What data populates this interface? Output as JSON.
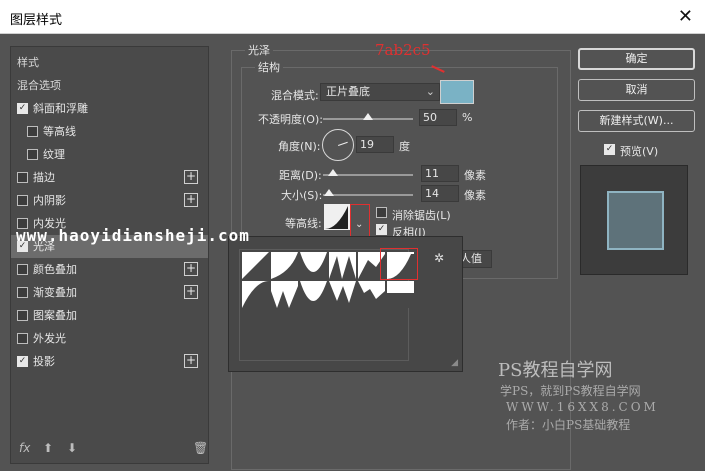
{
  "window": {
    "title": "图层样式",
    "close_label": "✕"
  },
  "left_list": {
    "header": "样式",
    "blend_options": "混合选项",
    "items": [
      {
        "label": "斜面和浮雕",
        "checked": true,
        "indent": 0,
        "plus": false
      },
      {
        "label": "等高线",
        "checked": false,
        "indent": 1,
        "plus": false
      },
      {
        "label": "纹理",
        "checked": false,
        "indent": 1,
        "plus": false
      },
      {
        "label": "描边",
        "checked": false,
        "indent": 0,
        "plus": true
      },
      {
        "label": "内阴影",
        "checked": false,
        "indent": 0,
        "plus": true
      },
      {
        "label": "内发光",
        "checked": false,
        "indent": 0,
        "plus": false
      },
      {
        "label": "光泽",
        "checked": true,
        "indent": 0,
        "plus": false,
        "selected": true
      },
      {
        "label": "颜色叠加",
        "checked": false,
        "indent": 0,
        "plus": true
      },
      {
        "label": "渐变叠加",
        "checked": false,
        "indent": 0,
        "plus": true
      },
      {
        "label": "图案叠加",
        "checked": false,
        "indent": 0,
        "plus": false
      },
      {
        "label": "外发光",
        "checked": false,
        "indent": 0,
        "plus": false
      },
      {
        "label": "投影",
        "checked": true,
        "indent": 0,
        "plus": true
      }
    ],
    "bottom": {
      "fx": "fx",
      "up": "⬆",
      "down": "⬇",
      "trash": "🗑"
    }
  },
  "satin": {
    "group_title": "光泽",
    "structure_title": "结构",
    "blend_mode_label": "混合模式:",
    "blend_mode_value": "正片叠底",
    "color_hex": "#7ab2c5",
    "opacity_label": "不透明度(O):",
    "opacity_value": "50",
    "opacity_unit": "%",
    "angle_label": "角度(N):",
    "angle_value": "19",
    "angle_unit": "度",
    "distance_label": "距离(D):",
    "distance_value": "11",
    "distance_unit": "像素",
    "size_label": "大小(S):",
    "size_value": "14",
    "size_unit": "像素",
    "contour_label": "等高线:",
    "antialias_label": "消除锯齿(L)",
    "antialias_checked": false,
    "invert_label": "反相(I)",
    "invert_checked": true,
    "reset_partial": "人值",
    "levels": {
      "opacity": 0.5,
      "distance": 0.11,
      "size": 0.07
    }
  },
  "buttons": {
    "ok": "确定",
    "cancel": "取消",
    "new_style": "新建样式(W)...",
    "preview_label": "预览(V)",
    "preview_checked": true
  },
  "annotation": {
    "text": "7ab2c5",
    "color": "#e03030"
  },
  "watermarks": {
    "url": "www.haoyidiansheji.com",
    "site": "PS教程自学网",
    "tagline": "学PS，就到PS教程自学网",
    "domain": "WWW.16XX8.COM",
    "author": "作者：小白PS基础教程"
  }
}
